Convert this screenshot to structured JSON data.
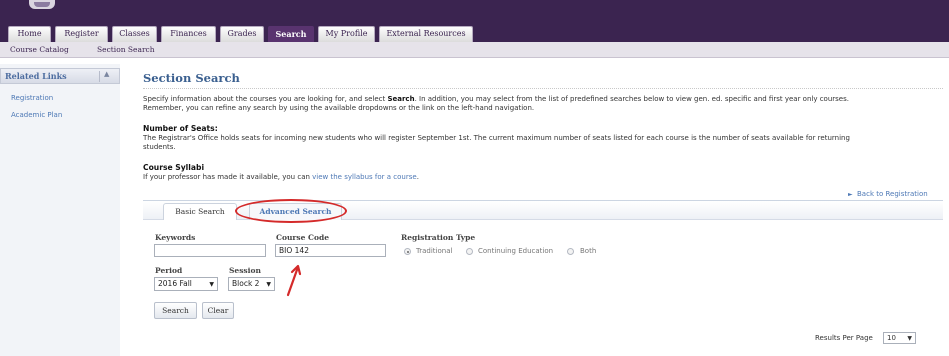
{
  "nav": {
    "tabs": [
      {
        "label": "Home"
      },
      {
        "label": "Register"
      },
      {
        "label": "Classes"
      },
      {
        "label": "Finances"
      },
      {
        "label": "Grades"
      },
      {
        "label": "Search",
        "active": true
      },
      {
        "label": "My Profile"
      },
      {
        "label": "External Resources"
      }
    ],
    "subtabs": [
      {
        "label": "Course Catalog"
      },
      {
        "label": "Section Search"
      }
    ]
  },
  "sidebar": {
    "title": "Related Links",
    "toggle_icon": "▲",
    "links": [
      {
        "label": "Registration"
      },
      {
        "label": "Academic Plan"
      }
    ]
  },
  "main": {
    "title": "Section Search",
    "intro": {
      "before": "Specify information about the courses you are looking for, and select ",
      "bold": "Search",
      "after": ". In addition, you may select from the list of predefined searches below to view gen. ed. specific and first year only courses.",
      "line2": "Remember, you can refine any search by using the available dropdowns or the link on the left-hand navigation."
    },
    "seats": {
      "heading": "Number of Seats:",
      "line1": "The Registrar's Office holds seats for incoming new students who will register September 1st. The current maximum number of seats listed for each course is the number of seats available for returning",
      "line2": "students."
    },
    "syllabi": {
      "heading": "Course Syllabi",
      "text": "If your professor has made it available, you can ",
      "link": "view the syllabus for a course",
      "end": "."
    },
    "back_link": "Back to Registration",
    "back_icon": "►"
  },
  "search": {
    "tabs": {
      "basic": "Basic Search",
      "advanced": "Advanced Search"
    },
    "keywords": {
      "label": "Keywords",
      "value": ""
    },
    "course_code": {
      "label": "Course Code",
      "value": "BIO 142"
    },
    "registration_type": {
      "label": "Registration Type",
      "options": [
        "Traditional",
        "Continuing Education",
        "Both"
      ],
      "selected": "Traditional"
    },
    "period": {
      "label": "Period",
      "value": "2016 Fall"
    },
    "session": {
      "label": "Session",
      "value": "Block 2"
    },
    "search_button": "Search",
    "clear_button": "Clear",
    "caret_icon": "▼"
  },
  "results": {
    "label": "Results Per Page",
    "value": "10"
  },
  "colors": {
    "brand_purple": "#3b2450",
    "active_tab": "#59336f",
    "link_blue": "#4d78b5",
    "annotation_red": "#d42a2a"
  }
}
